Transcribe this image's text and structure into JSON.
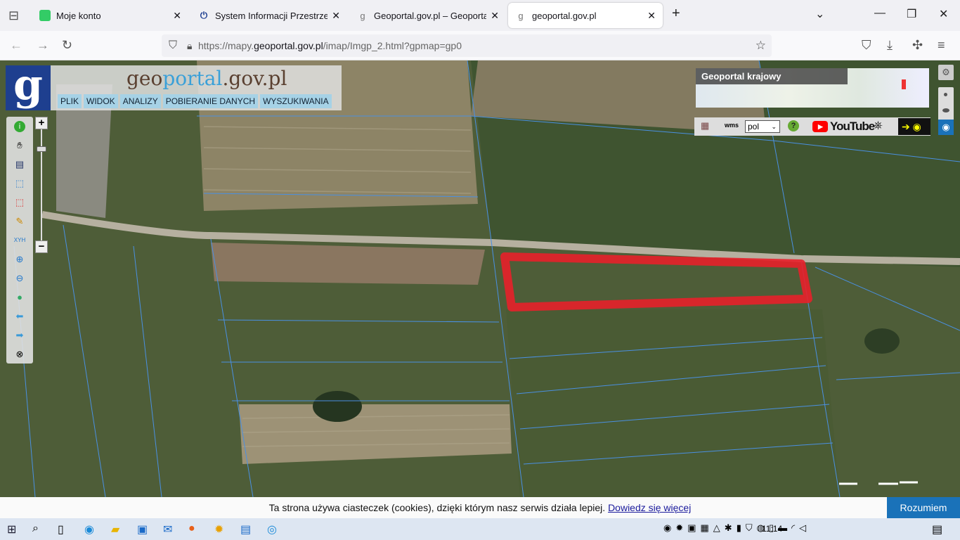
{
  "browser": {
    "tabs": [
      {
        "label": "Moje konto",
        "icon": "green-square-icon",
        "active": false
      },
      {
        "label": "System Informacji Przestrzennej",
        "icon": "power-icon",
        "active": false
      },
      {
        "label": "Geoportal.gov.pl – Geoportal Inf",
        "icon": "geoportal-icon",
        "active": false
      },
      {
        "label": "geoportal.gov.pl",
        "icon": "geoportal-icon",
        "active": true
      }
    ],
    "new_tab": "+",
    "url_prefix": "https://mapy.",
    "url_domain": "geoportal.gov.pl",
    "url_path": "/imap/Imgp_2.html?gpmap=gp0"
  },
  "app": {
    "logo": "g",
    "brand_a": "geo",
    "brand_b": "portal",
    "brand_c": ".gov.pl",
    "menu": [
      "PLIK",
      "WIDOK",
      "ANALIZY",
      "POBIERANIE DANYCH",
      "WYSZUKIWANIA"
    ],
    "overview_title": "Geoportal krajowy",
    "language": "pol",
    "youtube": "YouTube",
    "xyh": "XYH",
    "zoom_in": "+",
    "zoom_out": "−"
  },
  "cookie": {
    "text": "Ta strona używa ciasteczek (cookies), dzięki którym nasz serwis działa lepiej. ",
    "link": "Dowiedz się więcej",
    "button": "Rozumiem"
  },
  "taskbar": {
    "time": "11:14"
  },
  "colors": {
    "parcel_lines": "#4a90e2",
    "highlight": "#e8202a",
    "accent": "#1a72b9"
  }
}
